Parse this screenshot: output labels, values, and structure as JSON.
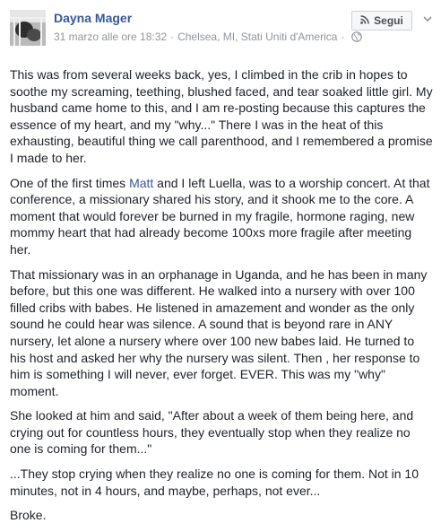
{
  "header": {
    "author_name": "Dayna Mager",
    "date": "31 marzo alle ore 18:32",
    "separator": "·",
    "location": "Chelsea, MI, Stati Uniti d'America",
    "separator2": "·",
    "follow_label": "Segui"
  },
  "icons": {
    "globe": "globe-icon",
    "rss": "rss-icon",
    "chevron": "chevron-down-icon"
  },
  "colors": {
    "link": "#365899",
    "meta": "#90949c",
    "text": "#1d2129"
  },
  "post": {
    "p1": "This was from several weeks back, yes, I climbed in the crib in hopes to soothe my screaming, teething, blushed faced, and tear soaked little girl. My husband came home to this, and I am re-posting because this captures the essence of my heart, and my \"why...\" There I was in the heat of this exhausting, beautiful thing we call parenthood, and I remembered a promise I made to her.",
    "p2_before": "One of the first times ",
    "p2_link": "Matt",
    "p2_after": " and I left Luella, was to a worship concert. At that conference, a missionary shared his story, and it shook me to the core. A moment that would forever be burned in my fragile, hormone raging, new mommy heart that had already become 100xs more fragile after meeting her.",
    "p3": "That missionary was in an orphanage in Uganda, and he has been in many before, but this one was different. He walked into a nursery with over 100 filled cribs with babes. He listened in amazement and wonder as the only sound he could hear was silence. A sound that is beyond rare in ANY nursery, let alone a nursery where over 100 new babes laid. He turned to his host and asked her why the nursery was silent. Then , her response to him is something I will never, ever forget. EVER. This was my \"why\" moment.",
    "p4": "She looked at him and said, \"After about a week of them being here, and crying out for countless hours, they eventually stop when they realize no one is coming for them...\"",
    "p5": "...They stop crying when they realize no one is coming for them. Not in 10 minutes, not in 4 hours, and maybe, perhaps, not ever...",
    "p6": "Broke."
  }
}
